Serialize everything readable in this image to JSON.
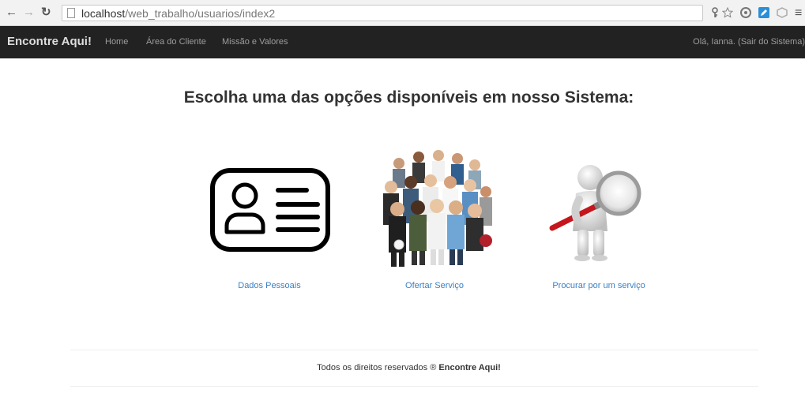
{
  "browser": {
    "url_host": "localhost",
    "url_path": "/web_trabalho/usuarios/index2"
  },
  "navbar": {
    "brand": "Encontre Aqui!",
    "links": [
      "Home",
      "Área do Cliente",
      "Missão e Valores"
    ],
    "user_text": "Olá, Ianna. (Sair do Sistema)"
  },
  "main": {
    "heading": "Escolha uma das opções disponíveis em nosso Sistema:",
    "options": [
      {
        "label": "Dados Pessoais",
        "icon": "id-card-icon"
      },
      {
        "label": "Ofertar Serviço",
        "icon": "people-group-image"
      },
      {
        "label": "Procurar por um serviço",
        "icon": "magnifier-figure-image"
      }
    ]
  },
  "footer": {
    "text": "Todos os direitos reservados ®",
    "brand": "Encontre Aqui!"
  },
  "colors": {
    "navbar_bg": "#222222",
    "link": "#3a7fc3"
  }
}
